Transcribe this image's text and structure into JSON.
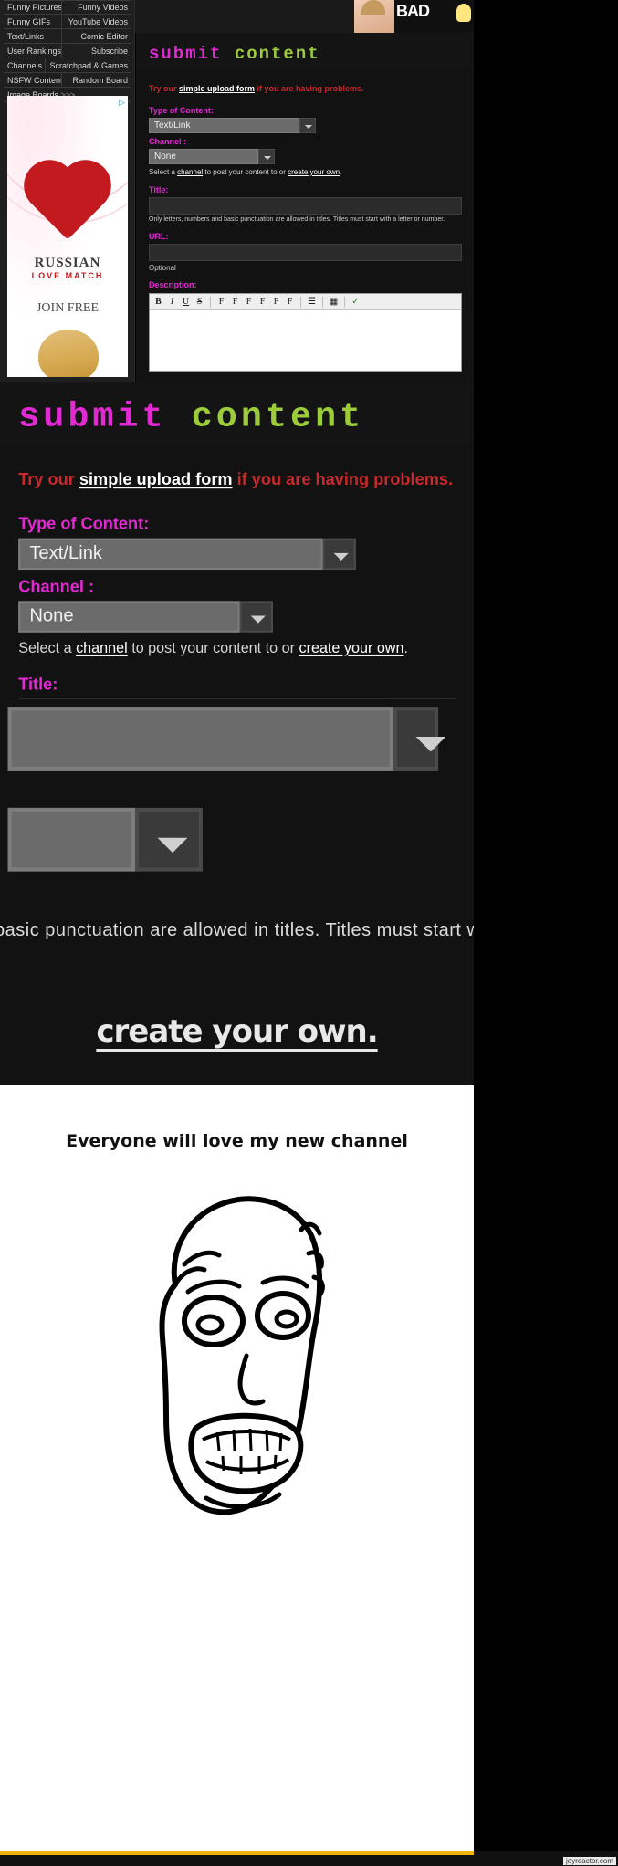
{
  "site": {
    "menu_rows": [
      {
        "left": "Funny Pictures",
        "right": "Funny Videos"
      },
      {
        "left": "Funny GIFs",
        "right": "YouTube Videos"
      },
      {
        "left": "Text/Links",
        "right": "Comic Editor"
      },
      {
        "left": "User Rankings",
        "right": "Subscribe"
      },
      {
        "left": "Channels",
        "right": "Scratchpad & Games"
      },
      {
        "left": "NSFW Content",
        "right": "Random Board"
      }
    ],
    "menu_last": {
      "label": "Image Boards",
      "chevrons": ">>>"
    }
  },
  "ad": {
    "adchoices_icon": "adchoices-icon",
    "brand": "RUSSIAN",
    "tagline": "LOVE MATCH",
    "cta": "JOIN FREE"
  },
  "banner": {
    "text": "BAD",
    "bulb_icon": "lightbulb-icon"
  },
  "form": {
    "title_part1": "submit",
    "title_part2": "content",
    "notice_pre": "Try our ",
    "notice_link": "simple upload form",
    "notice_post": " if you are having problems.",
    "type_label": "Type of Content:",
    "type_value": "Text/Link",
    "channel_label": "Channel :",
    "channel_value": "None",
    "channel_hint_pre": "Select a ",
    "channel_hint_link1": "channel",
    "channel_hint_mid": " to post your content to or ",
    "channel_hint_link2": "create your own",
    "channel_hint_post": ".",
    "title_label": "Title:",
    "title_value": "",
    "title_hint": "Only letters, numbers and basic punctuation are allowed in titles. Titles must start with a letter or number.",
    "url_label": "URL:",
    "url_value": "",
    "url_hint": "Optional",
    "description_label": "Description:",
    "editor_buttons": [
      "B",
      "I",
      "U",
      "S",
      "F",
      "F",
      "F",
      "F",
      "F",
      "F",
      "F"
    ],
    "editor_list_icon": "list-icon",
    "editor_table_icon": "table-icon",
    "editor_check_icon": "check-icon"
  },
  "zoom_panels": {
    "panel4_text": "basic punctuation are allowed in titles. Titles must start with a l",
    "panel5_text": "create your own."
  },
  "punchline": {
    "caption": "Everyone will love my new channel",
    "face": "rage-face-derp"
  },
  "footer": {
    "watermark": "joyreactor.com",
    "accent_color": "#f0b40a"
  },
  "colors": {
    "magenta": "#e22ad3",
    "green": "#9ccc3a",
    "red": "#c9282c",
    "page_bg": "#121212"
  }
}
